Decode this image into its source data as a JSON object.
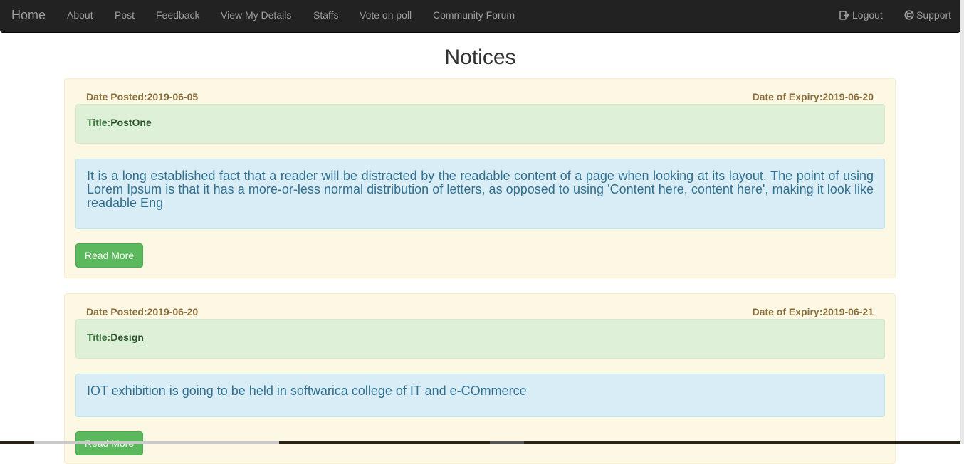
{
  "nav": {
    "brand": "Home",
    "items": [
      "About",
      "Post",
      "Feedback",
      "View My Details",
      "Staffs",
      "Vote on poll",
      "Community Forum"
    ],
    "logout": "Logout",
    "support": "Support",
    "logout_icon": "logout-icon",
    "support_icon": "lifebuoy-icon"
  },
  "page": {
    "title": "Notices"
  },
  "notices": [
    {
      "date_posted_label": "Date Posted:",
      "date_posted": "2019-06-05",
      "date_expiry_label": "Date of Expiry:",
      "date_expiry": "2019-06-20",
      "title_label": "Title:",
      "title": "PostOne",
      "body": "It is a long established fact that a reader will be distracted by the readable content of a page when looking at its layout. The point of using Lorem Ipsum is that it has a more-or-less normal distribution of letters, as opposed to using 'Content here, content here', making it look like readable Eng",
      "button": "Read More"
    },
    {
      "date_posted_label": "Date Posted:",
      "date_posted": "2019-06-20",
      "date_expiry_label": "Date of Expiry:",
      "date_expiry": "2019-06-21",
      "title_label": "Title:",
      "title": "Design",
      "body": "IOT exhibition is going to be held in softwarica college of IT and e-COmmerce",
      "button": "Read More"
    }
  ],
  "colors": {
    "navbar_bg": "#222222",
    "nav_text": "#9d9d9d",
    "panel_bg": "#fcf8e3",
    "title_bg": "#dff0d8",
    "body_bg": "#d9edf7",
    "button_bg": "#5cb85c"
  }
}
